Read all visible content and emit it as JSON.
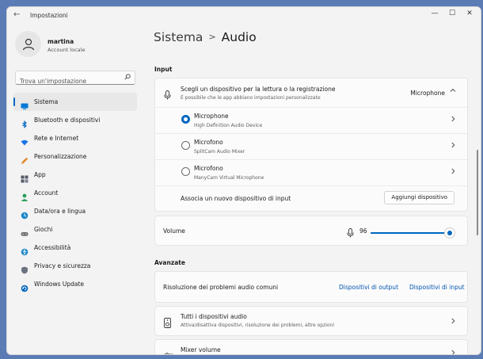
{
  "window": {
    "title": "Impostazioni",
    "back_glyph": "←",
    "controls": {
      "minimize": "—",
      "maximize": "☐",
      "close": "✕"
    }
  },
  "user": {
    "name": "martina",
    "account": "Account locale"
  },
  "search": {
    "placeholder": "Trova un'impostazione",
    "icon": "search-icon"
  },
  "sidebar": {
    "items": [
      {
        "label": "Sistema",
        "icon": "system-icon",
        "color": "#0078d4",
        "active": true
      },
      {
        "label": "Bluetooth e dispositivi",
        "icon": "bluetooth-icon",
        "color": "#0067c0"
      },
      {
        "label": "Rete e Internet",
        "icon": "network-icon",
        "color": "#1a73e8"
      },
      {
        "label": "Personalizzazione",
        "icon": "pencil-icon",
        "color": "#e08a2e"
      },
      {
        "label": "App",
        "icon": "apps-icon",
        "color": "#555a66"
      },
      {
        "label": "Account",
        "icon": "account-icon",
        "color": "#2ca05a"
      },
      {
        "label": "Data/ora e lingua",
        "icon": "globe-clock-icon",
        "color": "#1e88c8"
      },
      {
        "label": "Giochi",
        "icon": "gamepad-icon",
        "color": "#6b6b6b"
      },
      {
        "label": "Accessibilità",
        "icon": "accessibility-icon",
        "color": "#1e88c8"
      },
      {
        "label": "Privacy e sicurezza",
        "icon": "shield-icon",
        "color": "#6b7280"
      },
      {
        "label": "Windows Update",
        "icon": "update-icon",
        "color": "#0067c0"
      }
    ]
  },
  "breadcrumb": {
    "parent": "Sistema",
    "separator": ">",
    "current": "Audio"
  },
  "input": {
    "section_label": "Input",
    "header": {
      "title": "Scegli un dispositivo per la lettura o la registrazione",
      "subtitle": "È possibile che le app abbiano impostazioni personalizzate",
      "value": "Microphone",
      "icon": "microphone-icon"
    },
    "devices": [
      {
        "name": "Microphone",
        "detail": "High Definition Audio Device",
        "selected": true
      },
      {
        "name": "Microfono",
        "detail": "SplitCam Audio Mixer",
        "selected": false
      },
      {
        "name": "Microfono",
        "detail": "ManyCam Virtual Microphone",
        "selected": false
      }
    ],
    "add_device": {
      "label": "Associa un nuovo dispositivo di input",
      "button": "Aggiungi dispositivo"
    },
    "volume": {
      "label": "Volume",
      "value": "96",
      "fraction": 0.96
    }
  },
  "advanced": {
    "section_label": "Avanzate",
    "troubleshoot": {
      "label": "Risoluzione dei problemi audio comuni",
      "link_output": "Dispositivi di output",
      "link_input": "Dispositivi di input"
    },
    "all_devices": {
      "title": "Tutti i dispositivi audio",
      "subtitle": "Attiva/disattiva dispositivi, risoluzione dei problemi, altre opzioni",
      "icon": "speaker-device-icon"
    },
    "mixer": {
      "title": "Mixer volume",
      "icon": "mixer-icon"
    }
  },
  "accent": "#0067c0"
}
